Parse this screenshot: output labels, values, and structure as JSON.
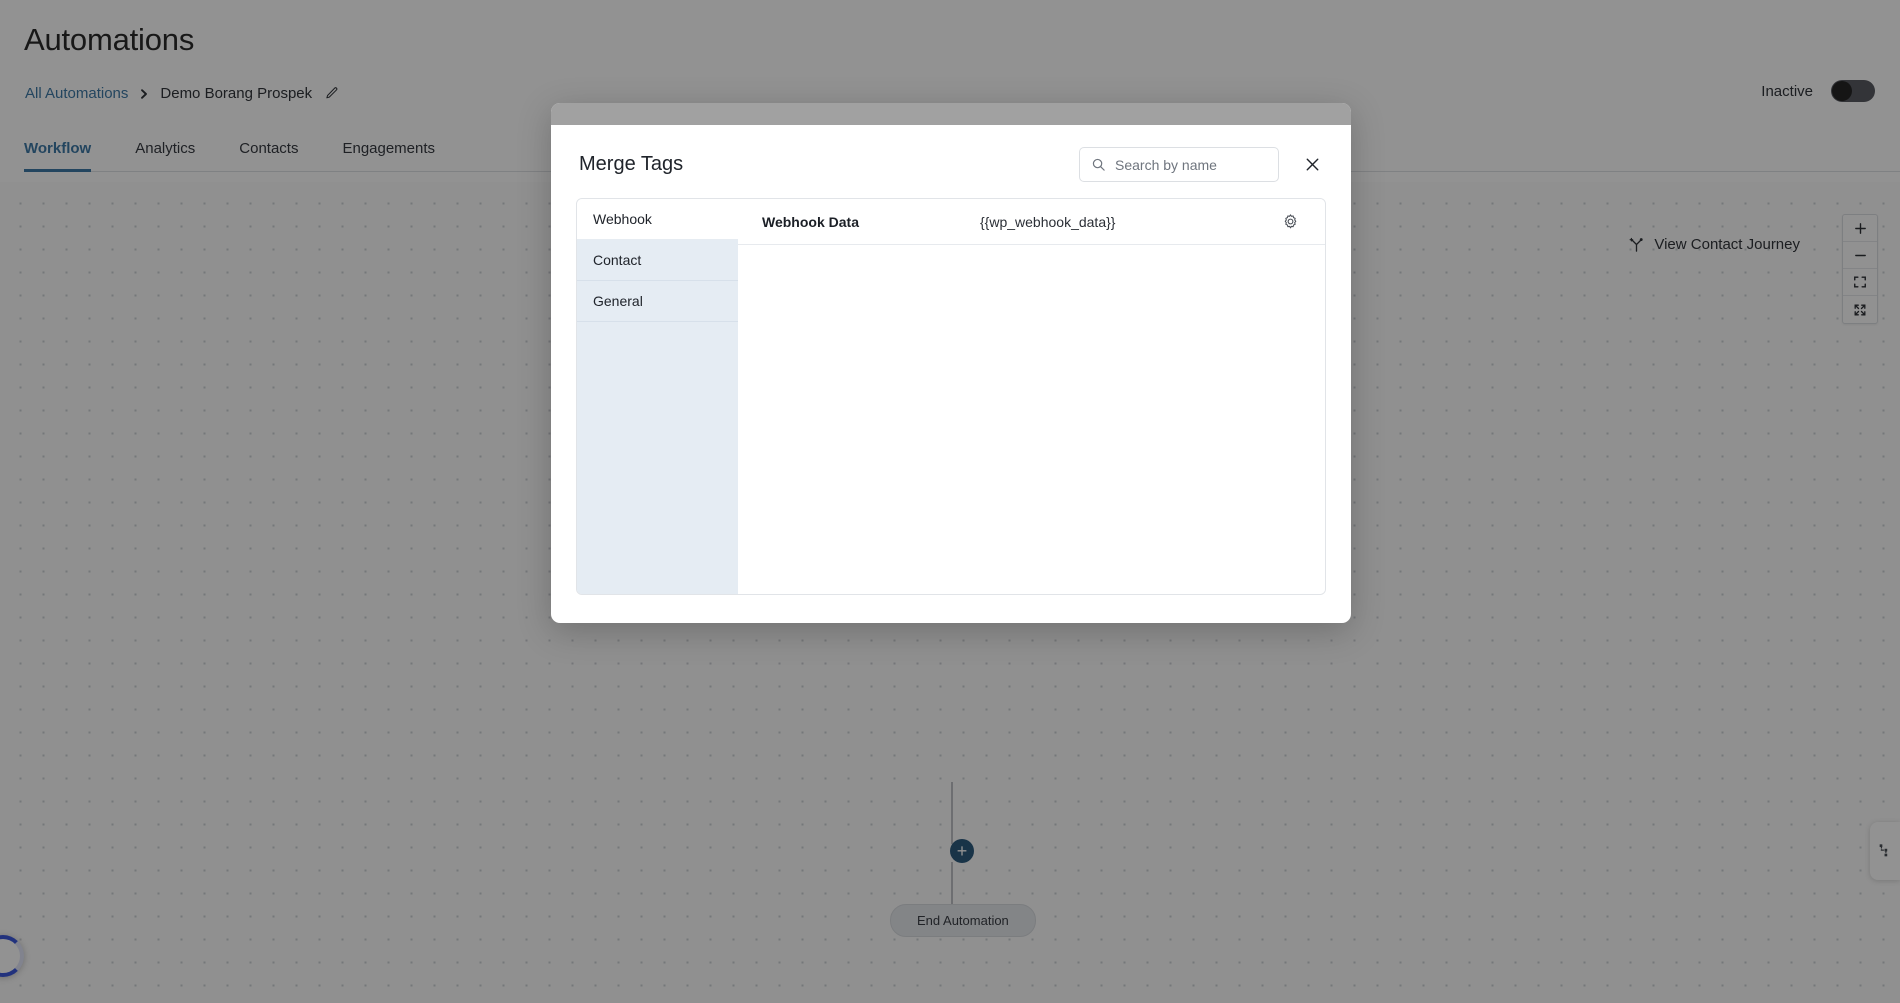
{
  "page": {
    "title": "Automations",
    "breadcrumb": {
      "root_label": "All Automations",
      "separator": "›",
      "current_label": "Demo Borang Prospek",
      "edit_icon": "pencil-icon"
    },
    "status": {
      "label": "Inactive",
      "toggle_on": false
    },
    "tabs": [
      {
        "label": "Workflow",
        "active": true
      },
      {
        "label": "Analytics",
        "active": false
      },
      {
        "label": "Contacts",
        "active": false
      },
      {
        "label": "Engagements",
        "active": false
      }
    ]
  },
  "canvas": {
    "journey_button": {
      "label": "View Contact Journey",
      "icon": "branch-icon"
    },
    "zoom_controls": [
      {
        "name": "zoom-in",
        "glyph": "+"
      },
      {
        "name": "zoom-out",
        "glyph": "−"
      },
      {
        "name": "fit-view",
        "glyph": "fit-view-icon"
      },
      {
        "name": "full-screen",
        "glyph": "full-screen-icon"
      }
    ],
    "add_node_label": "+",
    "end_node_label": "End Automation",
    "mini_widget_icon": "workflow-minimap-icon",
    "loading_indicator": "spinner"
  },
  "modal": {
    "title": "Merge Tags",
    "search": {
      "placeholder": "Search by name",
      "value": "",
      "icon": "search-icon"
    },
    "close_icon": "close-icon",
    "categories": [
      {
        "label": "Webhook",
        "active": true
      },
      {
        "label": "Contact",
        "active": false
      },
      {
        "label": "General",
        "active": false
      }
    ],
    "tags": [
      {
        "name": "Webhook Data",
        "code": "{{wp_webhook_data}}",
        "settings_icon": "gear-icon"
      }
    ]
  },
  "colors": {
    "accent_blue": "#2f6f9f",
    "node_blue": "#1c4e74",
    "sidebar_blue": "#e5ecf3",
    "spinner_blue": "#2c4bd8"
  }
}
